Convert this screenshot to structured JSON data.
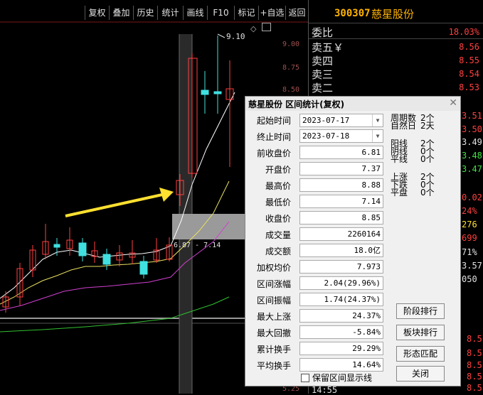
{
  "toolbar": {
    "items": [
      "复权",
      "叠加",
      "历史",
      "统计",
      "画线",
      "F10",
      "标记",
      "+自选",
      "返回"
    ]
  },
  "chart": {
    "y_ticks": [
      "9.00",
      "8.75",
      "8.50",
      "5.25"
    ],
    "high_label": "9.10",
    "range_label": "6.87 - 7.14"
  },
  "quote": {
    "code": "300307",
    "name": "慈星股份",
    "rows": [
      {
        "label": "委比",
        "value": "18.03%"
      },
      {
        "label": "卖五￥",
        "value": "8.56"
      },
      {
        "label": "卖四",
        "value": "8.55"
      },
      {
        "label": "卖三",
        "value": "8.54"
      },
      {
        "label": "卖二",
        "value": "8.53"
      }
    ],
    "fragments": [
      "3.51",
      "3.50",
      "3.49",
      "3.48",
      "3.47",
      "0.02",
      "24%",
      "276",
      "699",
      "71%",
      "3.57",
      "050",
      "8.5",
      "8.5",
      "8.5",
      "8.5",
      "8.5",
      "14:55"
    ]
  },
  "dialog": {
    "title": "慈星股份 区间统计(复权)",
    "start_label": "起始时间",
    "start_value": "2023-07-17",
    "end_label": "终止时间",
    "end_value": "2023-07-18",
    "fields": [
      {
        "label": "前收盘价",
        "value": "6.81"
      },
      {
        "label": "开盘价",
        "value": "7.37"
      },
      {
        "label": "最高价",
        "value": "8.88"
      },
      {
        "label": "最低价",
        "value": "7.14"
      },
      {
        "label": "收盘价",
        "value": "8.85"
      },
      {
        "label": "成交量",
        "value": "2260164"
      },
      {
        "label": "成交额",
        "value": "18.0亿"
      },
      {
        "label": "加权均价",
        "value": "7.973"
      },
      {
        "label": "区间涨幅",
        "value": "2.04(29.96%)"
      },
      {
        "label": "区间振幅",
        "value": "1.74(24.37%)"
      },
      {
        "label": "最大上涨",
        "value": "24.37%"
      },
      {
        "label": "最大回撤",
        "value": "-5.84%"
      },
      {
        "label": "累计换手",
        "value": "29.29%"
      },
      {
        "label": "平均换手",
        "value": "14.64%"
      }
    ],
    "stats": [
      {
        "label": "周期数",
        "value": "2个"
      },
      {
        "label": "自然日",
        "value": "2天"
      },
      {
        "label": "阳线",
        "value": "2个"
      },
      {
        "label": "阴线",
        "value": "0个"
      },
      {
        "label": "平线",
        "value": "0个"
      },
      {
        "label": "上涨",
        "value": "2个"
      },
      {
        "label": "下跌",
        "value": "0个"
      },
      {
        "label": "平盘",
        "value": "0个"
      }
    ],
    "buttons": [
      "阶段排行",
      "板块排行",
      "形态匹配",
      "关闭"
    ],
    "checkbox_label": "保留区间显示线"
  }
}
